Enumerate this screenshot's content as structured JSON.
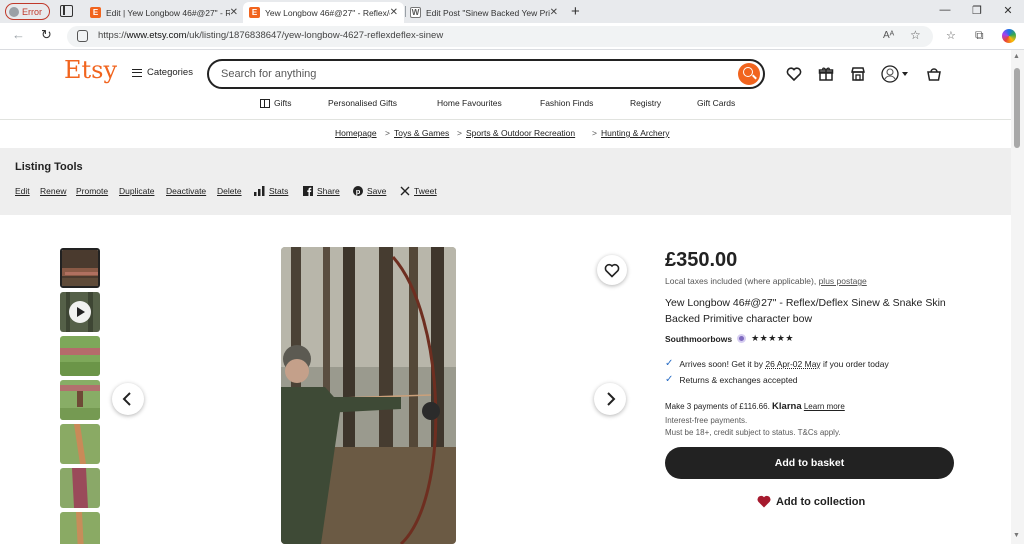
{
  "browser": {
    "profile_label": "Error",
    "tabs": [
      {
        "title": "Edit | Yew Longbow 46#@27\" - Re",
        "favicon": "E",
        "active": false
      },
      {
        "title": "Yew Longbow 46#@27\" - Reflex/c",
        "favicon": "E",
        "active": true
      },
      {
        "title": "Edit Post \"Sinew Backed Yew Prim",
        "favicon": "W",
        "active": false
      }
    ],
    "new_tab_label": "+",
    "url_prefix": "https://",
    "url_domain": "www.etsy.com",
    "url_path": "/uk/listing/1876838647/yew-longbow-4627-reflexdeflex-sinew",
    "read_aloud_label": "Aᴬ",
    "window_controls": [
      "—",
      "❐",
      "✕"
    ]
  },
  "header": {
    "logo": "Etsy",
    "categories_label": "Categories",
    "search_placeholder": "Search for anything"
  },
  "nav": {
    "items": [
      "Gifts",
      "Personalised Gifts",
      "Home Favourites",
      "Fashion Finds",
      "Registry",
      "Gift Cards"
    ]
  },
  "breadcrumb": {
    "items": [
      "Homepage",
      "Toys & Games",
      "Sports & Outdoor Recreation",
      "Hunting & Archery"
    ],
    "separator": ">"
  },
  "listing_tools": {
    "title": "Listing Tools",
    "links": [
      "Edit",
      "Renew",
      "Promote",
      "Duplicate",
      "Deactivate",
      "Delete",
      "Stats",
      "Share",
      "Save",
      "Tweet"
    ]
  },
  "product": {
    "price": "£350.00",
    "tax_text": "Local taxes included (where applicable),",
    "postage_link": "plus postage",
    "title": "Yew Longbow 46#@27\" - Reflex/Deflex Sinew & Snake Skin Backed Primitive character bow",
    "shop_name": "Southmoorbows",
    "rating_stars": "★★★★★",
    "rating": 5,
    "arrival_prefix": "Arrives soon! Get it by",
    "arrival_dates": "26 Apr-02 May",
    "arrival_suffix": "if you order today",
    "returns_text": "Returns & exchanges accepted",
    "klarna_text": "Make 3 payments of £116.66.",
    "klarna_brand": "Klarna",
    "klarna_link": "Learn more",
    "interest_free": "Interest-free payments.",
    "klarna_terms": "Must be 18+, credit subject to status. T&Cs apply.",
    "add_to_basket": "Add to basket",
    "add_to_collection": "Add to collection"
  },
  "colors": {
    "brand": "#f1641e",
    "dark": "#222222",
    "tools_bg": "#eeeeee",
    "heart": "#a61a2e"
  }
}
